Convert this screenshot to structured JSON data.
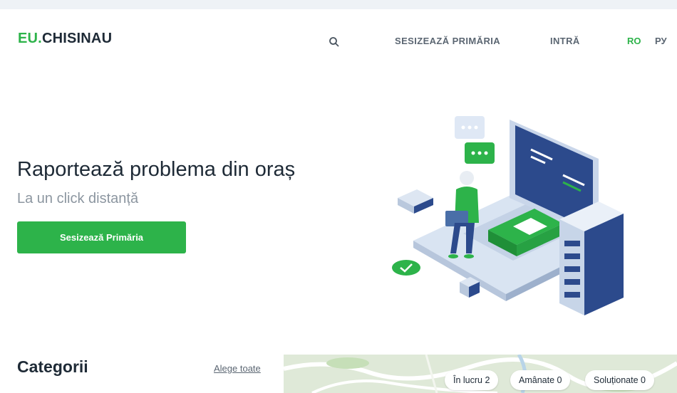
{
  "header": {
    "logo_prefix": "EU.",
    "logo_name": "CHISINAU",
    "search_icon": "search-icon",
    "nav": {
      "report": "SESIZEAZĂ PRIMĂRIA",
      "login": "INTRĂ"
    },
    "languages": [
      {
        "code": "RO",
        "active": true
      },
      {
        "code": "РУ",
        "active": false
      }
    ]
  },
  "hero": {
    "title": "Raportează problema din oraș",
    "subtitle": "La un click distanță",
    "cta_label": "Sesizează Primăria",
    "illustration": "person-with-laptop-and-server-illustration"
  },
  "categories": {
    "title": "Categorii",
    "choose_all": "Alege toate"
  },
  "map": {
    "filters": [
      {
        "label": "În lucru",
        "count": "2"
      },
      {
        "label": "Amânate",
        "count": "0"
      },
      {
        "label": "Soluționate",
        "count": "0"
      }
    ]
  },
  "colors": {
    "brand_green": "#2db34a",
    "dark_text": "#1e2a36",
    "muted_text": "#8c96a0",
    "illustration_blue": "#2c4a8c"
  }
}
